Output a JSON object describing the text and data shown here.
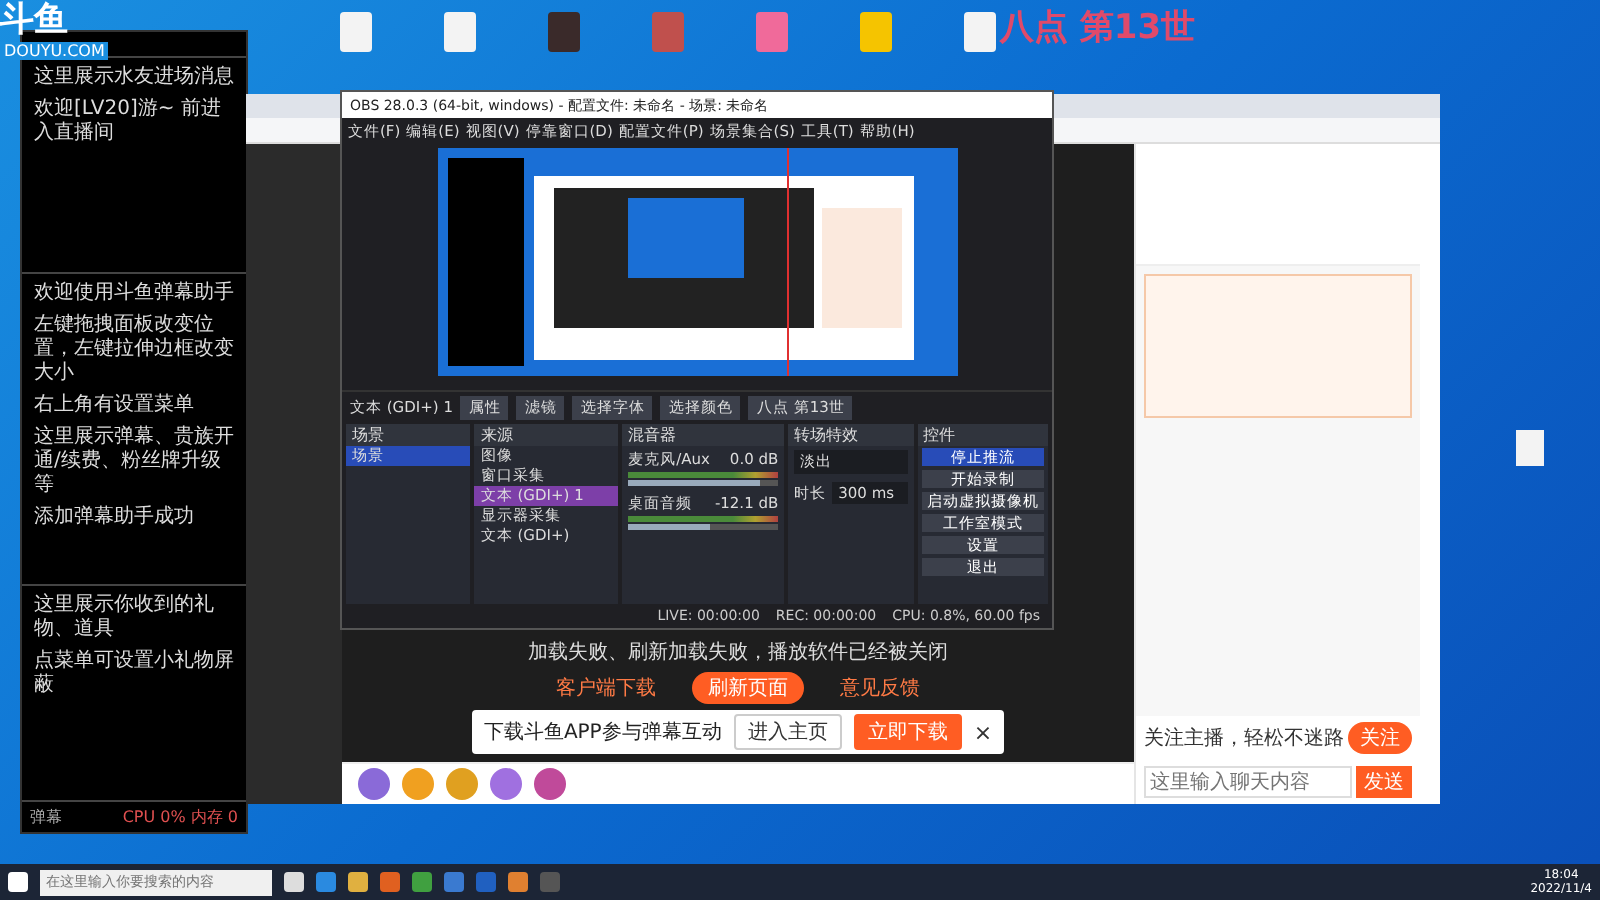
{
  "logo": {
    "text": "斗鱼",
    "sub": "DOUYU.COM"
  },
  "overlay_title": "八点 第13世",
  "desktop_icons": [
    {
      "color": "#f3f3f3"
    },
    {
      "color": "#f3f3f3"
    },
    {
      "color": "#3a2a2a"
    },
    {
      "color": "#c0504d"
    },
    {
      "color": "#f06a9a"
    },
    {
      "color": "#f5c400"
    },
    {
      "color": "#f3f3f3"
    }
  ],
  "danmu_panel": {
    "sections": [
      {
        "lines": [
          "这里展示水友进场消息",
          "欢迎[LV20]游~ 前进入直播间"
        ]
      },
      {
        "lines": [
          "欢迎使用斗鱼弹幕助手",
          "左键拖拽面板改变位置，左键拉伸边框改变大小",
          "右上角有设置菜单",
          "这里展示弹幕、贵族开通/续费、粉丝牌升级等",
          "添加弹幕助手成功"
        ]
      },
      {
        "lines": [
          "这里展示你收到的礼物、道具",
          "点菜单可设置小礼物屏蔽"
        ]
      }
    ],
    "status_left": "弹幕",
    "status_right": "CPU 0% 内存 0"
  },
  "obs": {
    "title": "OBS 28.0.3 (64-bit, windows) - 配置文件: 未命名 - 场景: 未命名",
    "menu": [
      "文件(F)",
      "编辑(E)",
      "视图(V)",
      "停靠窗口(D)",
      "配置文件(P)",
      "场景集合(S)",
      "工具(T)",
      "帮助(H)"
    ],
    "source_toolbar": {
      "source": "文本 (GDI+) 1",
      "buttons": [
        "属性",
        "滤镜",
        "选择字体",
        "选择颜色",
        "八点 第13世"
      ]
    },
    "scenes": {
      "title": "场景",
      "items": [
        {
          "label": "场景",
          "selected": true
        }
      ]
    },
    "sources": {
      "title": "来源",
      "items": [
        {
          "label": "图像",
          "selected": false
        },
        {
          "label": "窗口采集",
          "selected": false
        },
        {
          "label": "文本 (GDI+) 1",
          "selected": true
        },
        {
          "label": "显示器采集",
          "selected": false
        },
        {
          "label": "文本 (GDI+)",
          "selected": false
        }
      ]
    },
    "mixer": {
      "title": "混音器",
      "channels": [
        {
          "name": "麦克风/Aux",
          "reading": "0.0 dB",
          "level": 0.88
        },
        {
          "name": "桌面音频",
          "reading": "-12.1 dB",
          "level": 0.55
        }
      ]
    },
    "transitions": {
      "title": "转场特效",
      "type": "淡出",
      "duration_label": "时长",
      "duration": "300 ms"
    },
    "controls": {
      "title": "控件",
      "buttons": [
        {
          "label": "停止推流",
          "kind": "primary"
        },
        {
          "label": "开始录制",
          "kind": "normal"
        },
        {
          "label": "启动虚拟摄像机",
          "kind": "normal"
        },
        {
          "label": "工作室模式",
          "kind": "normal"
        },
        {
          "label": "设置",
          "kind": "normal"
        },
        {
          "label": "退出",
          "kind": "normal"
        }
      ]
    },
    "status": [
      "LIVE: 00:00:00",
      "REC: 00:00:00",
      "CPU: 0.8%, 60.00 fps"
    ]
  },
  "player": {
    "message": "加载失败、刷新加载失败，播放软件已经被关闭",
    "buttons": [
      {
        "label": "客户端下载",
        "kind": "link"
      },
      {
        "label": "刷新页面",
        "kind": "primary"
      },
      {
        "label": "意见反馈",
        "kind": "link"
      }
    ],
    "banner": {
      "text": "下载斗鱼APP参与弹幕互动",
      "buttons": [
        {
          "label": "进入主页",
          "kind": "outline"
        },
        {
          "label": "立即下载",
          "kind": "primary"
        }
      ],
      "close": "×"
    }
  },
  "chat": {
    "follow_text": "关注主播，轻松不迷路",
    "follow_button": "关注",
    "input_placeholder": "这里输入聊天内容",
    "send": "发送"
  },
  "taskbar": {
    "search_placeholder": "在这里输入你要搜索的内容",
    "time": "18:04",
    "date": "2022/11/4"
  }
}
